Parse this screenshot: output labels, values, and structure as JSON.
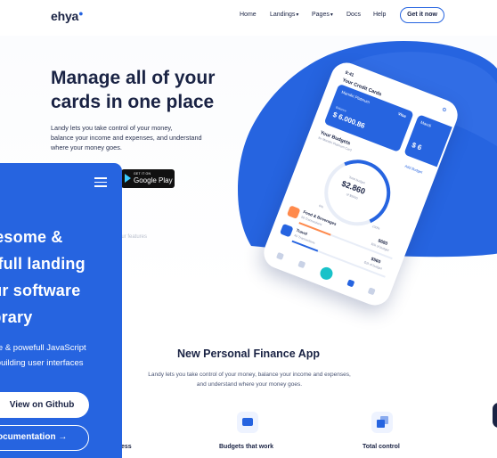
{
  "nav": {
    "logo": "ehya",
    "links": [
      {
        "label": "Home",
        "caret": ""
      },
      {
        "label": "Landings",
        "caret": "▾"
      },
      {
        "label": "Pages",
        "caret": "▾"
      },
      {
        "label": "Docs",
        "caret": ""
      },
      {
        "label": "Help",
        "caret": ""
      }
    ],
    "cta": "Get it now"
  },
  "hero": {
    "title_line1": "Manage all of your",
    "title_line2": "cards in one place",
    "lead_line1": "Landy lets you take control of your money,",
    "lead_line2": "balance your income and expenses, and understand",
    "lead_line3": "where your money goes.",
    "gplay_small": "GET IT ON",
    "gplay_big": "Google Play",
    "faint_text": "our features"
  },
  "phone": {
    "time": "9:41",
    "cards_title": "Your Credit Cards",
    "card_name": "Mandiri Platinum",
    "card_brand": "Visa",
    "card_balance_label": "Balance",
    "card_balance": "$ 6.000.86",
    "card2_name": "Mandi",
    "card2_balance": "$ 6",
    "budgets_title": "Your Budgets",
    "budgets_sub": "for Mandiri Platinum Card",
    "add_budget": "Add Budget",
    "gauge_label": "Total budget",
    "gauge_value": "$2.860",
    "gauge_sub": "of $5000",
    "gauge_min": "0%",
    "gauge_max": "100%",
    "rows": [
      {
        "title": "Food & Beverages",
        "sub": "56 Transactions",
        "amount": "$680",
        "of": "$2k of budget",
        "color": "#ff8a4c",
        "pct": 0.34
      },
      {
        "title": "Travel",
        "sub": "40 Transactions",
        "amount": "$560",
        "of": "$2k of budget",
        "color": "#2664e0",
        "pct": 0.28
      }
    ]
  },
  "mobile_overlay": {
    "title_lines": [
      "wesome &",
      "erfull landing",
      "our software",
      " library"
    ],
    "sub_lines": [
      "me & powefull JavaScript",
      "r building user interfaces"
    ],
    "github_button": "View on Github",
    "docs_button": "ocumentation →"
  },
  "section": {
    "title": "New Personal Finance App",
    "lead_line1": "Landy lets you take control of your money, balance your income and expenses,",
    "lead_line2": "and understand where your money goes.",
    "features": [
      "ess",
      "Budgets that work",
      "Total control"
    ]
  },
  "colors": {
    "primary": "#2664e0",
    "navy": "#1a2344",
    "accent_orange": "#ff8a4c",
    "accent_teal": "#19c2c9"
  }
}
